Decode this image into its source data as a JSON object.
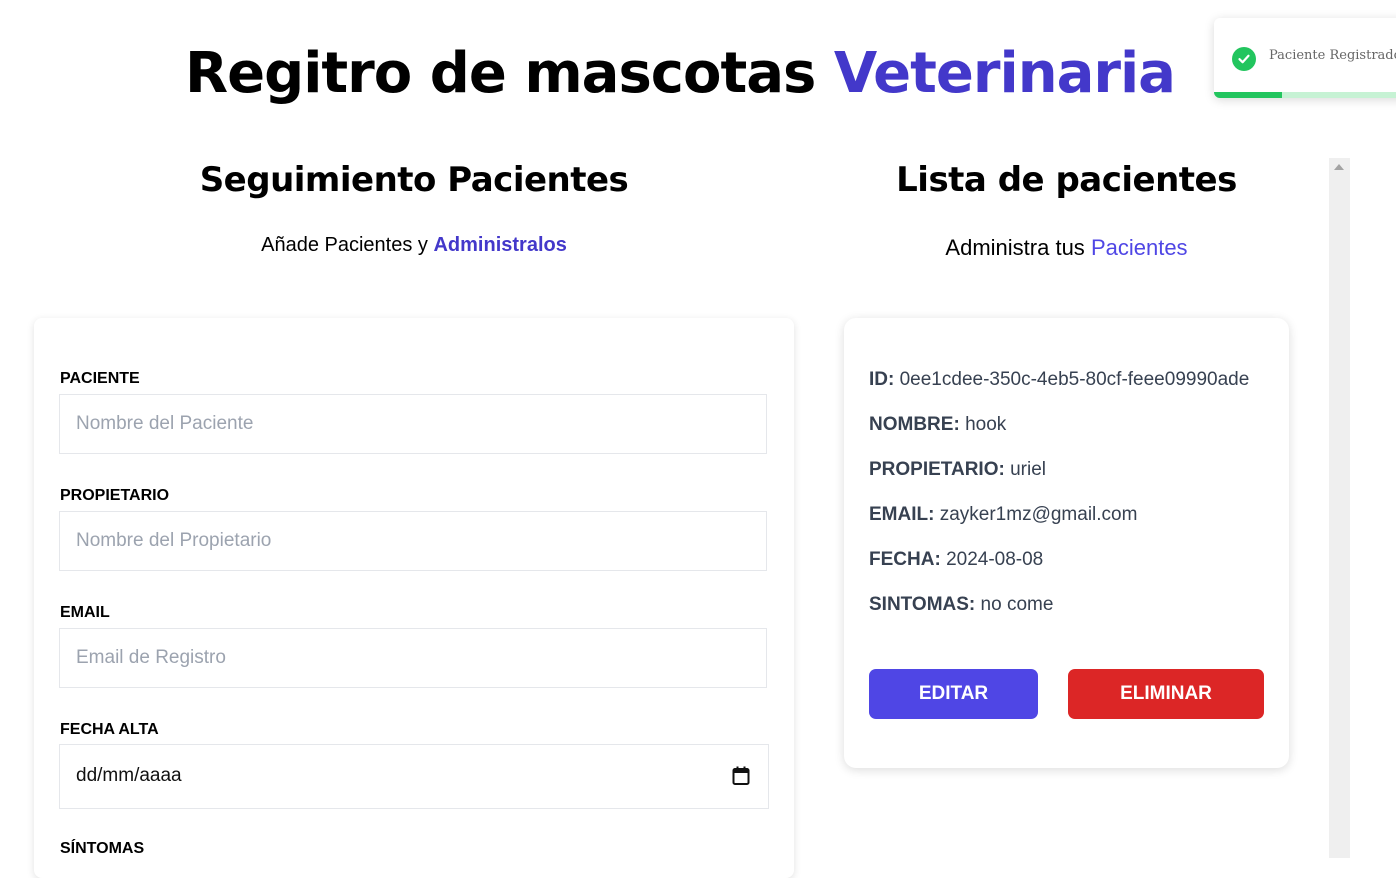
{
  "header": {
    "title_main": "Regitro de mascotas",
    "title_accent": "Veterinaria"
  },
  "toast": {
    "message": "Paciente Registrado C",
    "progress": 0.34,
    "icon": "check-circle-icon"
  },
  "form_section": {
    "title": "Seguimiento Pacientes",
    "subtitle_plain": "Añade Pacientes y",
    "subtitle_accent": "Administralos",
    "fields": {
      "paciente": {
        "label": "PACIENTE",
        "placeholder": "Nombre del Paciente"
      },
      "propietario": {
        "label": "PROPIETARIO",
        "placeholder": "Nombre del Propietario"
      },
      "email": {
        "label": "EMAIL",
        "placeholder": "Email de Registro"
      },
      "fecha": {
        "label": "FECHA ALTA",
        "value": "dd/mm/aaaa"
      },
      "sintomas": {
        "label": "SÍNTOMAS"
      }
    }
  },
  "list_section": {
    "title": "Lista de pacientes",
    "subtitle_plain": "Administra tus",
    "subtitle_accent": "Pacientes",
    "patient": {
      "id_label": "ID:",
      "id": "0ee1cdee-350c-4eb5-80cf-feee09990ade",
      "name_label": "NOMBRE:",
      "name": "hook",
      "owner_label": "PROPIETARIO:",
      "owner": "uriel",
      "email_label": "EMAIL:",
      "email": "zayker1mz@gmail.com",
      "date_label": "FECHA:",
      "date": "2024-08-08",
      "symptoms_label": "SINTOMAS:",
      "symptoms": "no come"
    },
    "edit_label": "Editar",
    "delete_label": "Eliminar"
  },
  "colors": {
    "accent": "#4338ca",
    "edit": "#4f46e5",
    "delete": "#dc2626",
    "success": "#22c55e"
  }
}
